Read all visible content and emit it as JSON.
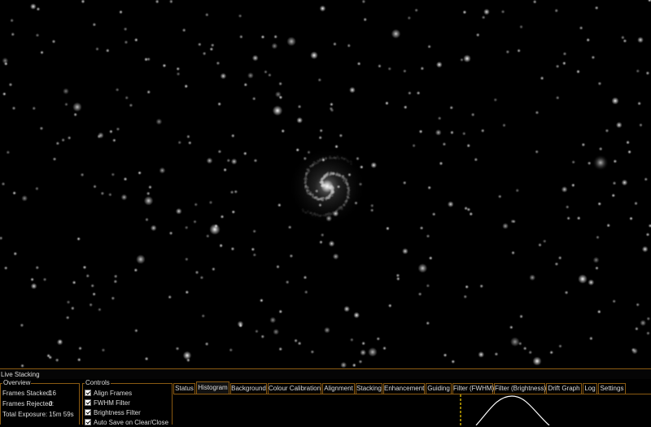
{
  "image": {
    "subject": "spiral-galaxy-star-field"
  },
  "live_stacking": {
    "title": "Live Stacking"
  },
  "overview": {
    "title": "Overview",
    "frames_stacked": {
      "label": "Frames Stacked:",
      "value": "16"
    },
    "frames_rejected": {
      "label": "Frames Rejected:",
      "value": "0"
    },
    "total_exposure": {
      "label": "Total Exposure:",
      "value": "15m 59s"
    }
  },
  "controls": {
    "title": "Controls",
    "options": [
      {
        "label": "Align Frames",
        "checked": true
      },
      {
        "label": "FWHM Filter",
        "checked": true
      },
      {
        "label": "Brightness Filter",
        "checked": true
      },
      {
        "label": "Auto Save on Clear/Close",
        "checked": true
      }
    ]
  },
  "tabs": {
    "active": "Histogram",
    "items": [
      "Status",
      "Histogram",
      "Background",
      "Colour Calibration",
      "Alignment",
      "Stacking",
      "Enhancement",
      "Guiding",
      "Filter (FWHM)",
      "Filter (Brightness)",
      "Drift Graph",
      "Log",
      "Settings"
    ]
  },
  "colors": {
    "accent": "#8a5a12",
    "histogram_marker": "#e6c200",
    "histogram_curve": "#ffffff"
  }
}
